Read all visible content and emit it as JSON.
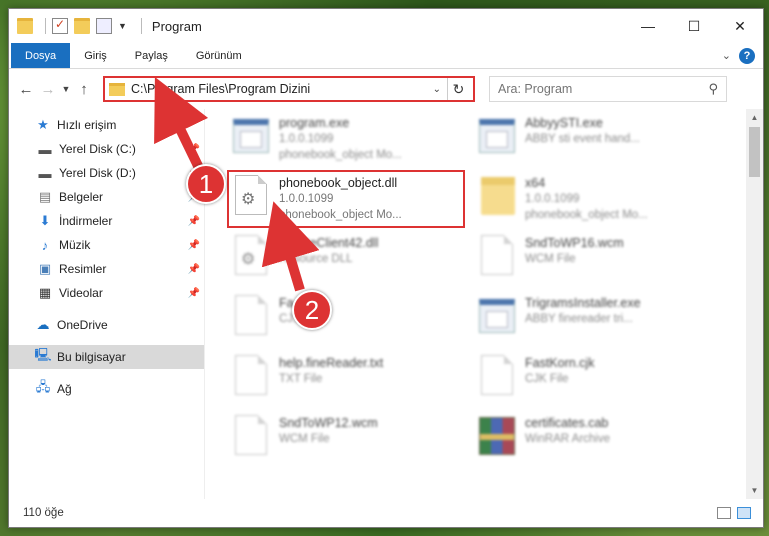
{
  "window": {
    "title": "Program",
    "controls": {
      "minimize": "—",
      "maximize": "☐",
      "close": "✕"
    }
  },
  "ribbon": {
    "tabs": [
      {
        "label": "Dosya"
      },
      {
        "label": "Giriş"
      },
      {
        "label": "Paylaş"
      },
      {
        "label": "Görünüm"
      }
    ],
    "help_label": "?"
  },
  "navigation": {
    "address": "C:\\Program Files\\Program Dizini",
    "search_placeholder": "Ara: Program"
  },
  "sidebar": {
    "items": [
      {
        "label": "Hızlı erişim",
        "icon": "star-icon",
        "pinned": false
      },
      {
        "label": "Yerel Disk (C:)",
        "icon": "drive-icon",
        "pinned": true
      },
      {
        "label": "Yerel Disk (D:)",
        "icon": "drive-icon",
        "pinned": true
      },
      {
        "label": "Belgeler",
        "icon": "documents-icon",
        "pinned": true
      },
      {
        "label": "İndirmeler",
        "icon": "download-icon",
        "pinned": true
      },
      {
        "label": "Müzik",
        "icon": "music-icon",
        "pinned": true
      },
      {
        "label": "Resimler",
        "icon": "pictures-icon",
        "pinned": true
      },
      {
        "label": "Videolar",
        "icon": "video-icon",
        "pinned": true
      },
      {
        "label": "OneDrive",
        "icon": "cloud-icon",
        "pinned": false
      },
      {
        "label": "Bu bilgisayar",
        "icon": "computer-icon",
        "pinned": false
      },
      {
        "label": "Ağ",
        "icon": "network-icon",
        "pinned": false
      }
    ]
  },
  "files": [
    {
      "name": "program.exe",
      "line2": "1.0.0.1099",
      "line3": "phonebook_object Mo...",
      "icon": "exe-icon"
    },
    {
      "name": "AbbyySTI.exe",
      "line2": "ABBY sti event hand...",
      "line3": "",
      "icon": "exe-icon"
    },
    {
      "name": "phonebook_object.dll",
      "line2": "1.0.0.1099",
      "line3": "phonebook_object Mo...",
      "icon": "dll-icon"
    },
    {
      "name": "x64",
      "line2": "1.0.0.1099",
      "line3": "phonebook_object Mo...",
      "icon": "folder-icon"
    },
    {
      "name": "CreateClient42.dll",
      "line2": "Resource DLL",
      "line3": "",
      "icon": "dll-icon"
    },
    {
      "name": "SndToWP16.wcm",
      "line2": "WCM File",
      "line3": "",
      "icon": "file-icon"
    },
    {
      "name": "Fa...t.cjk",
      "line2": "CJ...",
      "line3": "",
      "icon": "file-icon"
    },
    {
      "name": "TrigramsInstaller.exe",
      "line2": "ABBY finereader tri...",
      "line3": "",
      "icon": "exe-icon"
    },
    {
      "name": "help.fineReader.txt",
      "line2": "TXT File",
      "line3": "",
      "icon": "file-icon"
    },
    {
      "name": "FastKorn.cjk",
      "line2": "CJK File",
      "line3": "",
      "icon": "file-icon"
    },
    {
      "name": "SndToWP12.wcm",
      "line2": "WCM File",
      "line3": "",
      "icon": "file-icon"
    },
    {
      "name": "certificates.cab",
      "line2": "WinRAR Archive",
      "line3": "",
      "icon": "winrar-icon"
    }
  ],
  "status": {
    "count": "110 öğe"
  },
  "annotations": {
    "step1": "1",
    "step2": "2",
    "accent": "#d33333"
  }
}
